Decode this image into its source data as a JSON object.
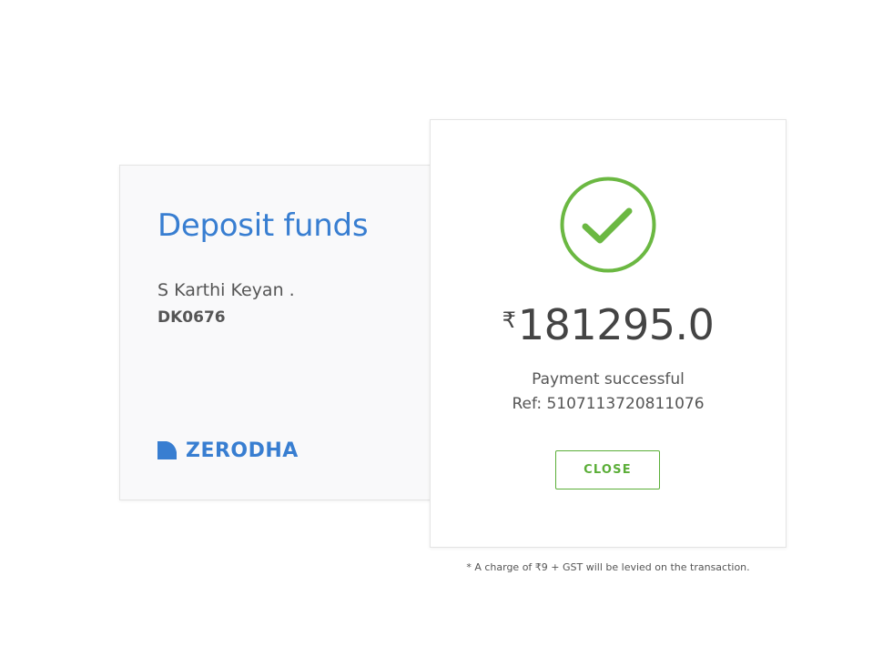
{
  "deposit": {
    "title": "Deposit funds",
    "client_name": "S Karthi Keyan .",
    "client_id": "DK0676",
    "brand": "ZERODHA"
  },
  "payment": {
    "currency_symbol": "₹",
    "amount": "181295.0",
    "status": "Payment successful",
    "reference": "Ref: 5107113720811076",
    "close_label": "CLOSE",
    "status_icon": "check-circle-icon",
    "success_color": "#5bae38"
  },
  "footer": {
    "charge_note": "* A charge of ₹9 + GST will be levied on the transaction."
  },
  "colors": {
    "brand_blue": "#387ed1",
    "text_gray": "#555555"
  }
}
